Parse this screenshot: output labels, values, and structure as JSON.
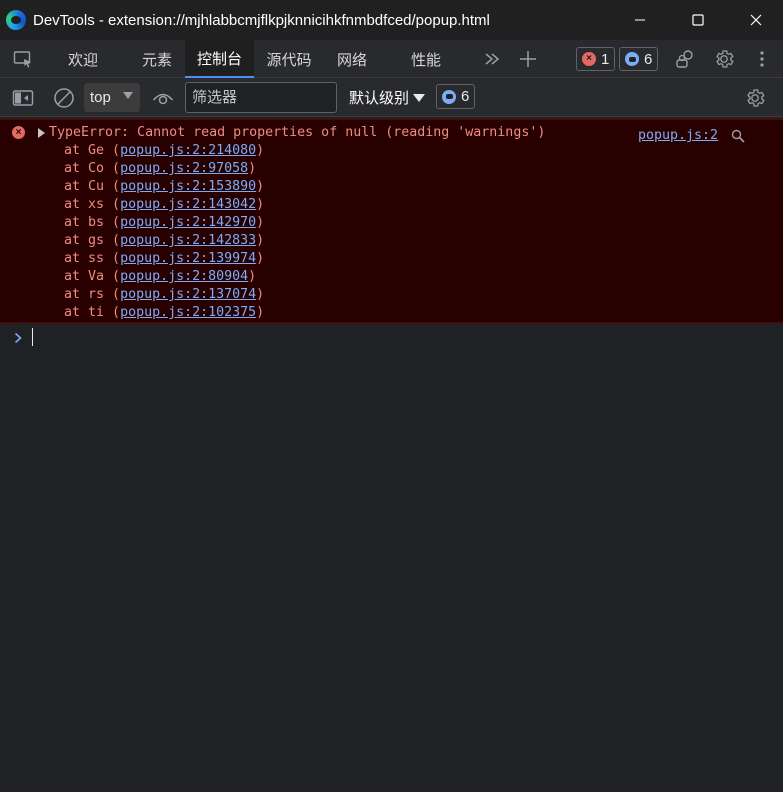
{
  "window": {
    "title": "DevTools - extension://mjhlabbcmjflkpjknnicihkfnmbdfced/popup.html"
  },
  "tabs": [
    {
      "label": "欢迎",
      "active": false
    },
    {
      "label": "元素",
      "active": false
    },
    {
      "label": "控制台",
      "active": true
    },
    {
      "label": "源代码",
      "active": false
    },
    {
      "label": "网络",
      "active": false
    },
    {
      "label": "性能",
      "active": false
    }
  ],
  "tabbar": {
    "error_count": "1",
    "issue_count": "6"
  },
  "toolbar": {
    "context": "top",
    "filter_placeholder": "筛选器",
    "level_label": "默认级别",
    "issue_count": "6"
  },
  "console": {
    "error_message": "TypeError: Cannot read properties of null (reading 'warnings')",
    "source_link": "popup.js:2",
    "frames": [
      {
        "func": "Ge",
        "loc": "popup.js:2:214080"
      },
      {
        "func": "Co",
        "loc": "popup.js:2:97058"
      },
      {
        "func": "Cu",
        "loc": "popup.js:2:153890"
      },
      {
        "func": "xs",
        "loc": "popup.js:2:143042"
      },
      {
        "func": "bs",
        "loc": "popup.js:2:142970"
      },
      {
        "func": "gs",
        "loc": "popup.js:2:142833"
      },
      {
        "func": "ss",
        "loc": "popup.js:2:139974"
      },
      {
        "func": "Va",
        "loc": "popup.js:2:80904"
      },
      {
        "func": "rs",
        "loc": "popup.js:2:137074"
      },
      {
        "func": "ti",
        "loc": "popup.js:2:102375"
      }
    ]
  },
  "colors": {
    "error_text": "#f28b82",
    "link": "#7cacf8",
    "error_bg": "#290000",
    "accent": "#4c8df6"
  }
}
